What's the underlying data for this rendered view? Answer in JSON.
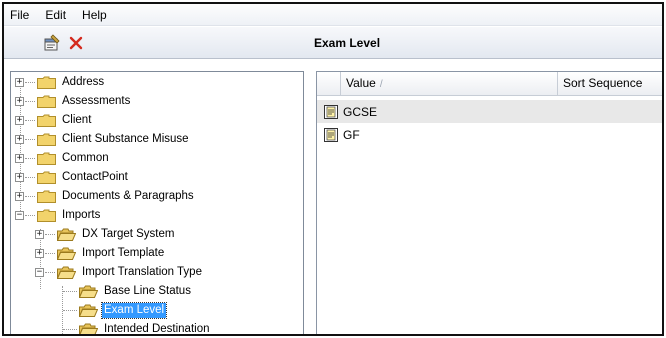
{
  "menu": {
    "file": "File",
    "edit": "Edit",
    "help": "Help"
  },
  "panel_title": "Exam Level",
  "tree": {
    "items": [
      {
        "label": "Address"
      },
      {
        "label": "Assessments"
      },
      {
        "label": "Client"
      },
      {
        "label": "Client Substance Misuse"
      },
      {
        "label": "Common"
      },
      {
        "label": "ContactPoint"
      },
      {
        "label": "Documents & Paragraphs"
      },
      {
        "label": "Imports"
      },
      {
        "label": "DX Target System"
      },
      {
        "label": "Import Template"
      },
      {
        "label": "Import Translation Type"
      },
      {
        "label": "Base Line Status"
      },
      {
        "label": "Exam Level"
      },
      {
        "label": "Intended Destination"
      }
    ]
  },
  "grid": {
    "columns": {
      "value": "Value",
      "sort": "Sort Sequence",
      "sort_indicator": "/"
    },
    "rows": [
      {
        "value": "GCSE",
        "sort": ""
      },
      {
        "value": "GF",
        "sort": ""
      }
    ]
  },
  "colors": {
    "selection": "#3399ff",
    "folder": "#f2d36b",
    "delete": "#d42a1e"
  }
}
